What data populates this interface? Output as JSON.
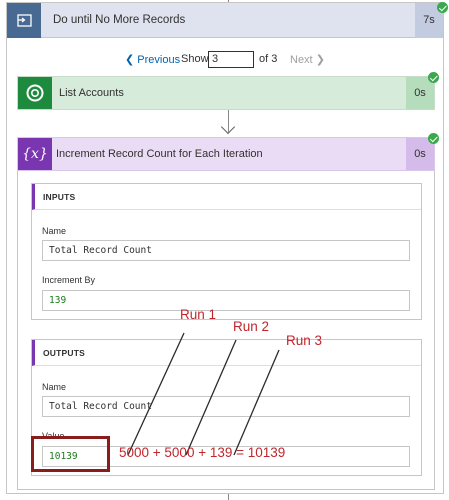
{
  "loop": {
    "title": "Do until No More Records",
    "duration": "7s"
  },
  "pager": {
    "previous_label": "Previous",
    "show_label": "Show",
    "current_page": "3",
    "of_label": "of 3",
    "next_label": "Next"
  },
  "list_accounts": {
    "title": "List Accounts",
    "duration": "0s"
  },
  "increment": {
    "icon_text": "{x}",
    "title": "Increment Record Count for Each Iteration",
    "duration": "0s",
    "inputs": {
      "header": "INPUTS",
      "name_label": "Name",
      "name_value": "Total Record Count",
      "increment_label": "Increment By",
      "increment_value": "139"
    },
    "outputs": {
      "header": "OUTPUTS",
      "name_label": "Name",
      "name_value": "Total Record Count",
      "value_label": "Value",
      "value_value": "10139"
    }
  },
  "annotations": {
    "run1": "Run 1",
    "run2": "Run 2",
    "run3": "Run 3",
    "equation": "5000 + 5000 + 139 = 10139",
    "color": "#c0262d"
  },
  "colors": {
    "loop_header": "#dfe3ef",
    "loop_icon": "#486991",
    "list_card": "#d6ebd9",
    "list_icon": "#1e8a3e",
    "variable_card": "#eadcf5",
    "variable_icon": "#7a36b0",
    "success": "#3aa84d",
    "link": "#0063b1",
    "highlight_box": "#8b1c1c"
  },
  "icons": {
    "loop": "loop-icon",
    "list_accounts": "dataverse-icon",
    "variable": "variable-icon",
    "status": "success-check-icon"
  }
}
